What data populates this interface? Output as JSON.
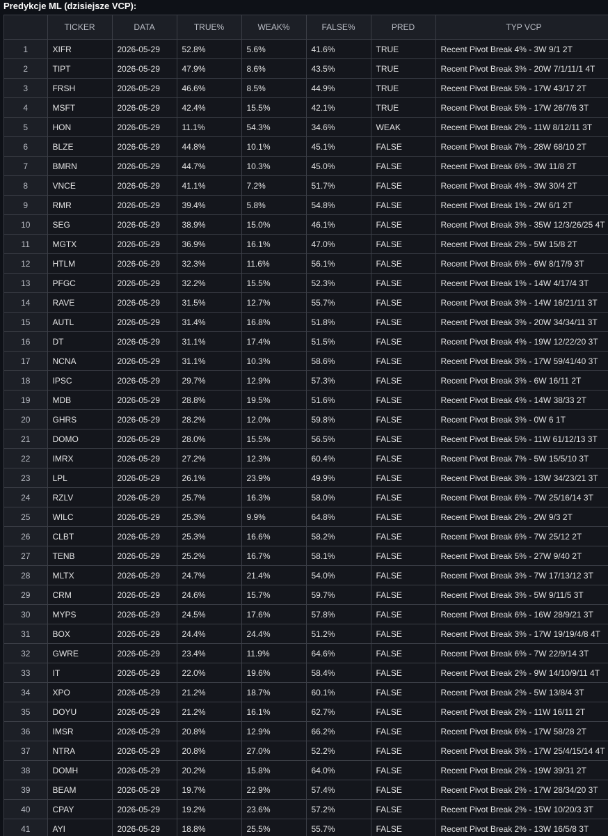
{
  "title": "Predykcje ML (dzisiejsze VCP):",
  "columns": [
    "",
    "TICKER",
    "DATA",
    "TRUE%",
    "WEAK%",
    "FALSE%",
    "PRED",
    "TYP VCP"
  ],
  "rows": [
    [
      "1",
      "XIFR",
      "2026-05-29",
      "52.8%",
      "5.6%",
      "41.6%",
      "TRUE",
      "Recent Pivot Break 4% - 3W 9/1 2T"
    ],
    [
      "2",
      "TIPT",
      "2026-05-29",
      "47.9%",
      "8.6%",
      "43.5%",
      "TRUE",
      "Recent Pivot Break 3% - 20W 7/1/11/1 4T"
    ],
    [
      "3",
      "FRSH",
      "2026-05-29",
      "46.6%",
      "8.5%",
      "44.9%",
      "TRUE",
      "Recent Pivot Break 5% - 17W 43/17 2T"
    ],
    [
      "4",
      "MSFT",
      "2026-05-29",
      "42.4%",
      "15.5%",
      "42.1%",
      "TRUE",
      "Recent Pivot Break 5% - 17W 26/7/6 3T"
    ],
    [
      "5",
      "HON",
      "2026-05-29",
      "11.1%",
      "54.3%",
      "34.6%",
      "WEAK",
      "Recent Pivot Break 2% - 11W 8/12/11 3T"
    ],
    [
      "6",
      "BLZE",
      "2026-05-29",
      "44.8%",
      "10.1%",
      "45.1%",
      "FALSE",
      "Recent Pivot Break 7% - 28W 68/10 2T"
    ],
    [
      "7",
      "BMRN",
      "2026-05-29",
      "44.7%",
      "10.3%",
      "45.0%",
      "FALSE",
      "Recent Pivot Break 6% - 3W 11/8 2T"
    ],
    [
      "8",
      "VNCE",
      "2026-05-29",
      "41.1%",
      "7.2%",
      "51.7%",
      "FALSE",
      "Recent Pivot Break 4% - 3W 30/4 2T"
    ],
    [
      "9",
      "RMR",
      "2026-05-29",
      "39.4%",
      "5.8%",
      "54.8%",
      "FALSE",
      "Recent Pivot Break 1% - 2W 6/1 2T"
    ],
    [
      "10",
      "SEG",
      "2026-05-29",
      "38.9%",
      "15.0%",
      "46.1%",
      "FALSE",
      "Recent Pivot Break 3% - 35W 12/3/26/25 4T"
    ],
    [
      "11",
      "MGTX",
      "2026-05-29",
      "36.9%",
      "16.1%",
      "47.0%",
      "FALSE",
      "Recent Pivot Break 2% - 5W 15/8 2T"
    ],
    [
      "12",
      "HTLM",
      "2026-05-29",
      "32.3%",
      "11.6%",
      "56.1%",
      "FALSE",
      "Recent Pivot Break 6% - 6W 8/17/9 3T"
    ],
    [
      "13",
      "PFGC",
      "2026-05-29",
      "32.2%",
      "15.5%",
      "52.3%",
      "FALSE",
      "Recent Pivot Break 1% - 14W 4/17/4 3T"
    ],
    [
      "14",
      "RAVE",
      "2026-05-29",
      "31.5%",
      "12.7%",
      "55.7%",
      "FALSE",
      "Recent Pivot Break 3% - 14W 16/21/11 3T"
    ],
    [
      "15",
      "AUTL",
      "2026-05-29",
      "31.4%",
      "16.8%",
      "51.8%",
      "FALSE",
      "Recent Pivot Break 3% - 20W 34/34/11 3T"
    ],
    [
      "16",
      "DT",
      "2026-05-29",
      "31.1%",
      "17.4%",
      "51.5%",
      "FALSE",
      "Recent Pivot Break 4% - 19W 12/22/20 3T"
    ],
    [
      "17",
      "NCNA",
      "2026-05-29",
      "31.1%",
      "10.3%",
      "58.6%",
      "FALSE",
      "Recent Pivot Break 3% - 17W 59/41/40 3T"
    ],
    [
      "18",
      "IPSC",
      "2026-05-29",
      "29.7%",
      "12.9%",
      "57.3%",
      "FALSE",
      "Recent Pivot Break 3% - 6W 16/11 2T"
    ],
    [
      "19",
      "MDB",
      "2026-05-29",
      "28.8%",
      "19.5%",
      "51.6%",
      "FALSE",
      "Recent Pivot Break 4% - 14W 38/33 2T"
    ],
    [
      "20",
      "GHRS",
      "2026-05-29",
      "28.2%",
      "12.0%",
      "59.8%",
      "FALSE",
      "Recent Pivot Break 3% - 0W 6 1T"
    ],
    [
      "21",
      "DOMO",
      "2026-05-29",
      "28.0%",
      "15.5%",
      "56.5%",
      "FALSE",
      "Recent Pivot Break 5% - 11W 61/12/13 3T"
    ],
    [
      "22",
      "IMRX",
      "2026-05-29",
      "27.2%",
      "12.3%",
      "60.4%",
      "FALSE",
      "Recent Pivot Break 7% - 5W 15/5/10 3T"
    ],
    [
      "23",
      "LPL",
      "2026-05-29",
      "26.1%",
      "23.9%",
      "49.9%",
      "FALSE",
      "Recent Pivot Break 3% - 13W 34/23/21 3T"
    ],
    [
      "24",
      "RZLV",
      "2026-05-29",
      "25.7%",
      "16.3%",
      "58.0%",
      "FALSE",
      "Recent Pivot Break 6% - 7W 25/16/14 3T"
    ],
    [
      "25",
      "WILC",
      "2026-05-29",
      "25.3%",
      "9.9%",
      "64.8%",
      "FALSE",
      "Recent Pivot Break 2% - 2W 9/3 2T"
    ],
    [
      "26",
      "CLBT",
      "2026-05-29",
      "25.3%",
      "16.6%",
      "58.2%",
      "FALSE",
      "Recent Pivot Break 6% - 7W 25/12 2T"
    ],
    [
      "27",
      "TENB",
      "2026-05-29",
      "25.2%",
      "16.7%",
      "58.1%",
      "FALSE",
      "Recent Pivot Break 5% - 27W 9/40 2T"
    ],
    [
      "28",
      "MLTX",
      "2026-05-29",
      "24.7%",
      "21.4%",
      "54.0%",
      "FALSE",
      "Recent Pivot Break 3% - 7W 17/13/12 3T"
    ],
    [
      "29",
      "CRM",
      "2026-05-29",
      "24.6%",
      "15.7%",
      "59.7%",
      "FALSE",
      "Recent Pivot Break 3% - 5W 9/11/5 3T"
    ],
    [
      "30",
      "MYPS",
      "2026-05-29",
      "24.5%",
      "17.6%",
      "57.8%",
      "FALSE",
      "Recent Pivot Break 6% - 16W 28/9/21 3T"
    ],
    [
      "31",
      "BOX",
      "2026-05-29",
      "24.4%",
      "24.4%",
      "51.2%",
      "FALSE",
      "Recent Pivot Break 3% - 17W 19/19/4/8 4T"
    ],
    [
      "32",
      "GWRE",
      "2026-05-29",
      "23.4%",
      "11.9%",
      "64.6%",
      "FALSE",
      "Recent Pivot Break 6% - 7W 22/9/14 3T"
    ],
    [
      "33",
      "IT",
      "2026-05-29",
      "22.0%",
      "19.6%",
      "58.4%",
      "FALSE",
      "Recent Pivot Break 2% - 9W 14/10/9/11 4T"
    ],
    [
      "34",
      "XPO",
      "2026-05-29",
      "21.2%",
      "18.7%",
      "60.1%",
      "FALSE",
      "Recent Pivot Break 2% - 5W 13/8/4 3T"
    ],
    [
      "35",
      "DOYU",
      "2026-05-29",
      "21.2%",
      "16.1%",
      "62.7%",
      "FALSE",
      "Recent Pivot Break 2% - 11W 16/11 2T"
    ],
    [
      "36",
      "IMSR",
      "2026-05-29",
      "20.8%",
      "12.9%",
      "66.2%",
      "FALSE",
      "Recent Pivot Break 6% - 17W 58/28 2T"
    ],
    [
      "37",
      "NTRA",
      "2026-05-29",
      "20.8%",
      "27.0%",
      "52.2%",
      "FALSE",
      "Recent Pivot Break 3% - 17W 25/4/15/14 4T"
    ],
    [
      "38",
      "DOMH",
      "2026-05-29",
      "20.2%",
      "15.8%",
      "64.0%",
      "FALSE",
      "Recent Pivot Break 2% - 19W 39/31 2T"
    ],
    [
      "39",
      "BEAM",
      "2026-05-29",
      "19.7%",
      "22.9%",
      "57.4%",
      "FALSE",
      "Recent Pivot Break 2% - 17W 28/34/20 3T"
    ],
    [
      "40",
      "CPAY",
      "2026-05-29",
      "19.2%",
      "23.6%",
      "57.2%",
      "FALSE",
      "Recent Pivot Break 2% - 15W 10/20/3 3T"
    ],
    [
      "41",
      "AYI",
      "2026-05-29",
      "18.8%",
      "25.5%",
      "55.7%",
      "FALSE",
      "Recent Pivot Break 2% - 13W 16/5/8 3T"
    ]
  ]
}
